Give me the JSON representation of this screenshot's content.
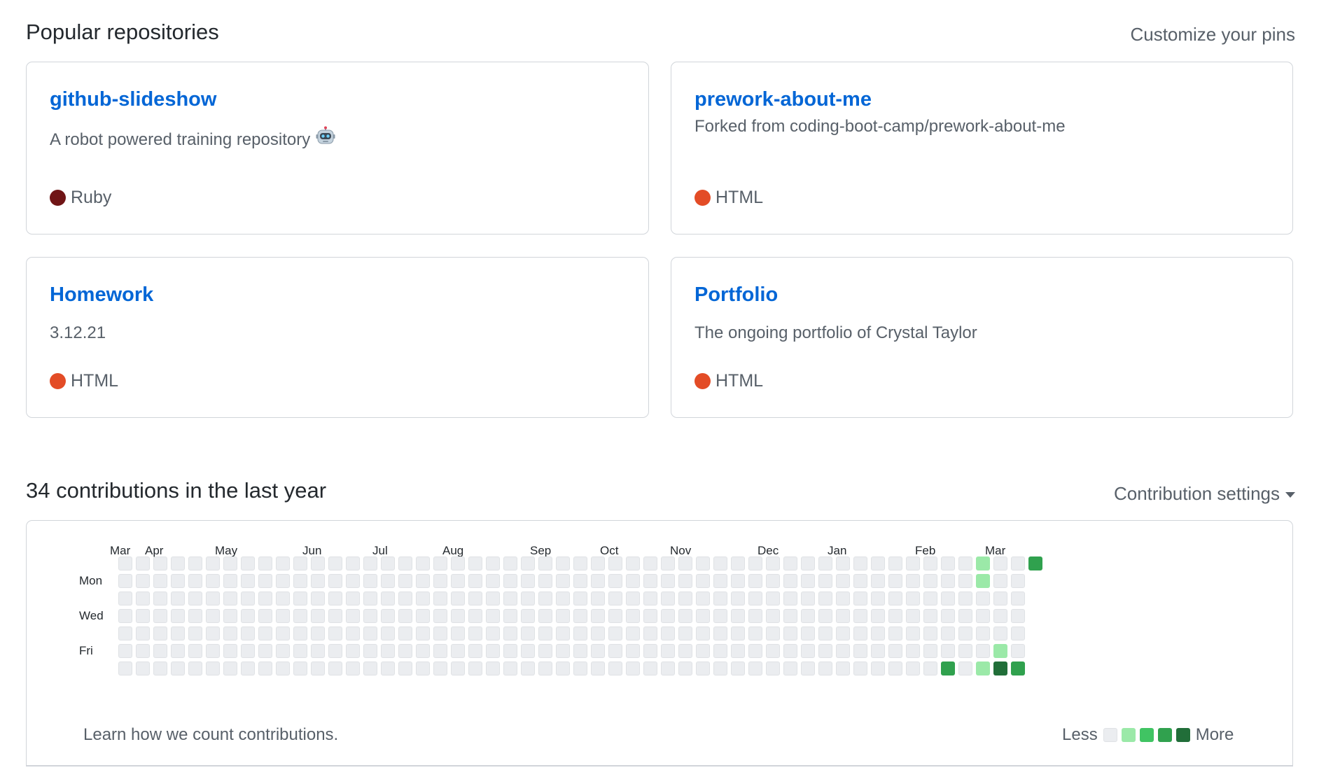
{
  "pinned": {
    "title": "Popular repositories",
    "customize_label": "Customize your pins",
    "repos": [
      {
        "name": "github-slideshow",
        "description": "A robot powered training repository",
        "description_icon": "robot-icon",
        "language": "Ruby",
        "language_color": "#701516"
      },
      {
        "name": "prework-about-me",
        "description": "Forked from coding-boot-camp/prework-about-me",
        "language": "HTML",
        "language_color": "#e34c26"
      },
      {
        "name": "Homework",
        "description": "3.12.21",
        "language": "HTML",
        "language_color": "#e34c26"
      },
      {
        "name": "Portfolio",
        "description": "The ongoing portfolio of Crystal Taylor",
        "language": "HTML",
        "language_color": "#e34c26"
      }
    ]
  },
  "contributions": {
    "title": "34 contributions in the last year",
    "settings_label": "Contribution settings",
    "months": [
      "Mar",
      "Apr",
      "May",
      "Jun",
      "Jul",
      "Aug",
      "Sep",
      "Oct",
      "Nov",
      "Dec",
      "Jan",
      "Feb",
      "Mar"
    ],
    "month_week_index": [
      0,
      2,
      6,
      11,
      15,
      19,
      24,
      28,
      32,
      37,
      41,
      46,
      50
    ],
    "day_labels": [
      "Mon",
      "Wed",
      "Fri"
    ],
    "day_label_rows": [
      1,
      3,
      5
    ],
    "week_count": 53,
    "last_week_days": 1,
    "level_colors": [
      "#ebedf0",
      "#9be9a8",
      "#40c463",
      "#30a14e",
      "#216e39"
    ],
    "active_cells": [
      {
        "week": 47,
        "day": 6,
        "level": 3
      },
      {
        "week": 49,
        "day": 0,
        "level": 1
      },
      {
        "week": 49,
        "day": 1,
        "level": 1
      },
      {
        "week": 49,
        "day": 6,
        "level": 1
      },
      {
        "week": 50,
        "day": 5,
        "level": 1
      },
      {
        "week": 50,
        "day": 6,
        "level": 4
      },
      {
        "week": 51,
        "day": 6,
        "level": 3
      },
      {
        "week": 52,
        "day": 0,
        "level": 3
      }
    ],
    "learn_label": "Learn how we count contributions.",
    "legend_less": "Less",
    "legend_more": "More"
  }
}
